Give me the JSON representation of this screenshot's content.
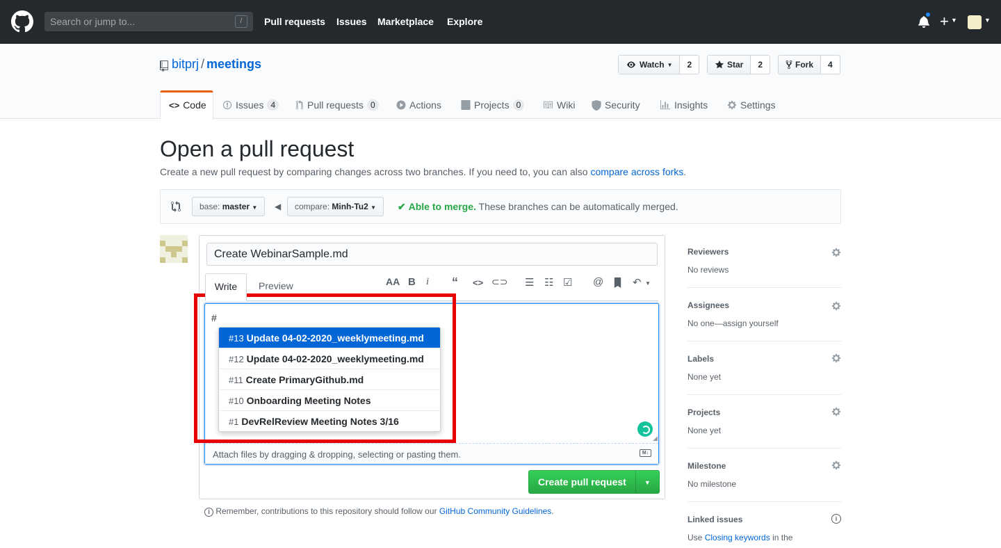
{
  "header": {
    "search_placeholder": "Search or jump to...",
    "search_key": "/",
    "nav": [
      "Pull requests",
      "Issues",
      "Marketplace",
      "Explore"
    ]
  },
  "repo": {
    "owner": "bitprj",
    "separator": "/",
    "name": "meetings",
    "watch_label": "Watch",
    "watch_count": "2",
    "star_label": "Star",
    "star_count": "2",
    "fork_label": "Fork",
    "fork_count": "4"
  },
  "tabs": {
    "code": "Code",
    "issues": "Issues",
    "issues_count": "4",
    "pulls": "Pull requests",
    "pulls_count": "0",
    "actions": "Actions",
    "projects": "Projects",
    "projects_count": "0",
    "wiki": "Wiki",
    "security": "Security",
    "insights": "Insights",
    "settings": "Settings"
  },
  "page": {
    "title": "Open a pull request",
    "subtitle": "Create a new pull request by comparing changes across two branches. If you need to, you can also ",
    "subtitle_link": "compare across forks",
    "subtitle_end": "."
  },
  "compare": {
    "base_label": "base:",
    "base_value": "master",
    "compare_label": "compare:",
    "compare_value": "Minh-Tu2",
    "status_ok": "Able to merge.",
    "status_text": " These branches can be automatically merged."
  },
  "composer": {
    "title_value": "Create WebinarSample.md",
    "write_tab": "Write",
    "preview_tab": "Preview",
    "body_text": "#",
    "attach_text": "Attach files by dragging & dropping, selecting or pasting them.",
    "md_badge": "M↓",
    "submit_label": "Create pull request"
  },
  "suggestions": [
    {
      "num": "#13",
      "text": "Update 04-02-2020_weeklymeeting.md"
    },
    {
      "num": "#12",
      "text": "Update 04-02-2020_weeklymeeting.md"
    },
    {
      "num": "#11",
      "text": "Create PrimaryGithub.md"
    },
    {
      "num": "#10",
      "text": "Onboarding Meeting Notes"
    },
    {
      "num": "#1",
      "text": "DevRelReview Meeting Notes 3/16"
    }
  ],
  "guidelines": {
    "text": "Remember, contributions to this repository should follow our ",
    "link": "GitHub Community Guidelines",
    "end": "."
  },
  "sidebar": {
    "reviewers": {
      "title": "Reviewers",
      "value": "No reviews"
    },
    "assignees": {
      "title": "Assignees",
      "value": "No one—assign yourself"
    },
    "labels": {
      "title": "Labels",
      "value": "None yet"
    },
    "projects": {
      "title": "Projects",
      "value": "None yet"
    },
    "milestone": {
      "title": "Milestone",
      "value": "No milestone"
    },
    "linked": {
      "title": "Linked issues",
      "pre": "Use ",
      "link": "Closing keywords",
      "post": " in the"
    }
  },
  "colors": {
    "header_bg": "#24292e",
    "accent_blue": "#0366d6",
    "merge_green": "#28a745",
    "highlight_red": "#e80000",
    "tab_orange": "#e36209"
  },
  "icons": [
    "github-logo",
    "bell-icon",
    "plus-icon",
    "repo-icon",
    "eye-icon",
    "star-icon",
    "fork-icon",
    "code-icon",
    "issue-icon",
    "pull-request-icon",
    "play-icon",
    "project-icon",
    "book-icon",
    "shield-icon",
    "graph-icon",
    "gear-icon",
    "compare-icon",
    "arrow-left-icon",
    "check-icon",
    "info-icon"
  ]
}
